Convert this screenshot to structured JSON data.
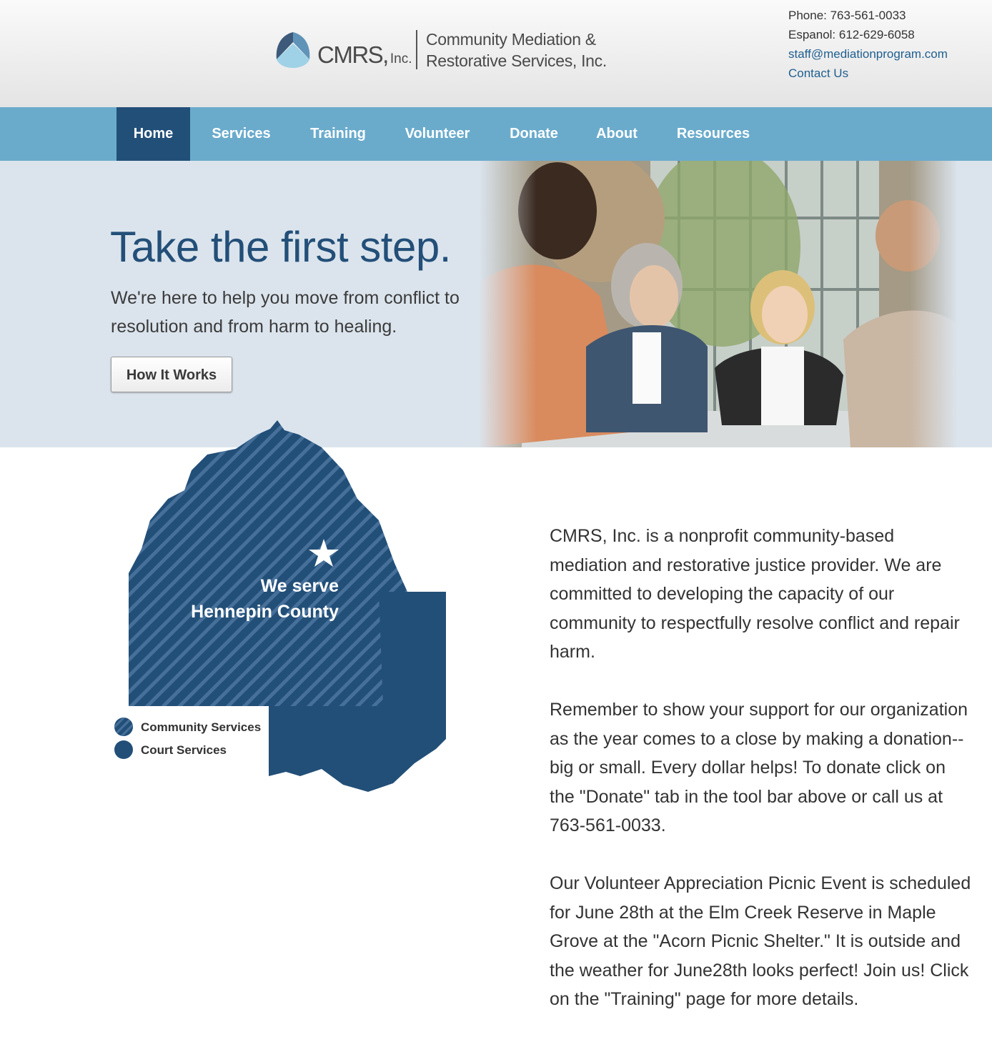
{
  "header": {
    "logo": {
      "short_name": "CMRS,",
      "suffix": "Inc.",
      "full_name_line1": "Community Mediation &",
      "full_name_line2": "Restorative Services, Inc."
    },
    "contact": {
      "phone": "Phone: 763-561-0033",
      "espanol": "Espanol: 612-629-6058",
      "email": "staff@mediationprogram.com",
      "contact_link": "Contact Us"
    }
  },
  "nav": {
    "items": [
      {
        "label": "Home",
        "active": true
      },
      {
        "label": "Services",
        "active": false
      },
      {
        "label": "Training",
        "active": false
      },
      {
        "label": "Volunteer",
        "active": false
      },
      {
        "label": "Donate",
        "active": false
      },
      {
        "label": "About",
        "active": false
      },
      {
        "label": "Resources",
        "active": false
      }
    ]
  },
  "hero": {
    "title": "Take the first step.",
    "subtitle": "We're here to help you move from conflict to resolution and from harm to healing.",
    "button_label": "How It Works"
  },
  "map": {
    "line1": "We serve",
    "line2": "Hennepin County",
    "legend": [
      {
        "label": "Community Services",
        "pattern": "striped"
      },
      {
        "label": "Court Services",
        "pattern": "solid"
      }
    ]
  },
  "content": {
    "paragraphs": [
      "CMRS, Inc. is a nonprofit community-based mediation and restorative justice provider. We are committed to developing the capacity of our community to respectfully resolve conflict and repair harm.",
      "Remember to show your support for our organization as the year comes to a close by making a donation-- big or small. Every dollar helps! To donate click on the \"Donate\" tab in the tool bar above or call us at 763-561-0033.",
      "Our Volunteer Appreciation Picnic Event is scheduled for June 28th at the Elm Creek Reserve in Maple Grove at the \"Acorn Picnic Shelter.\" It is outside and the weather for June28th looks perfect! Join us! Click on the \"Training\" page for more details."
    ]
  },
  "colors": {
    "nav_bg": "#6aabcc",
    "nav_active": "#224f78",
    "hero_bg": "#dbe4ed",
    "title_blue": "#234f78",
    "link_blue": "#1f5f8f"
  }
}
